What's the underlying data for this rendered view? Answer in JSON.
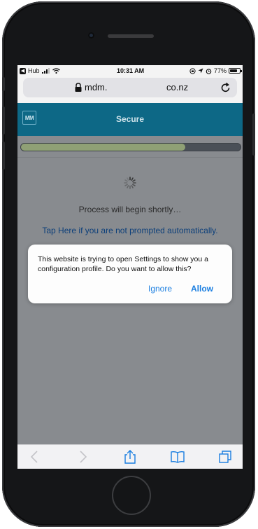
{
  "status_bar": {
    "back_app": "Hub",
    "time": "10:31 AM",
    "battery": "77%",
    "battery_level": 0.77
  },
  "browser": {
    "url_host": "mdm.",
    "url_tld": "co.nz"
  },
  "app_header": {
    "logo_text": "MM",
    "title": "Secure"
  },
  "page": {
    "progress": 0.75,
    "process_text": "Process will begin shortly…",
    "tap_link": "Tap Here if you are not prompted automatically."
  },
  "dialog": {
    "message": "This website is trying to open Settings to show you a configuration profile. Do you want to allow this?",
    "ignore_label": "Ignore",
    "allow_label": "Allow"
  },
  "colors": {
    "app_bar": "#0d6886",
    "progress_fill": "#8fa075",
    "link": "#1a7ee0"
  },
  "toolbar": {
    "icons": [
      "back-icon",
      "forward-icon",
      "share-icon",
      "bookmarks-icon",
      "tabs-icon"
    ]
  }
}
